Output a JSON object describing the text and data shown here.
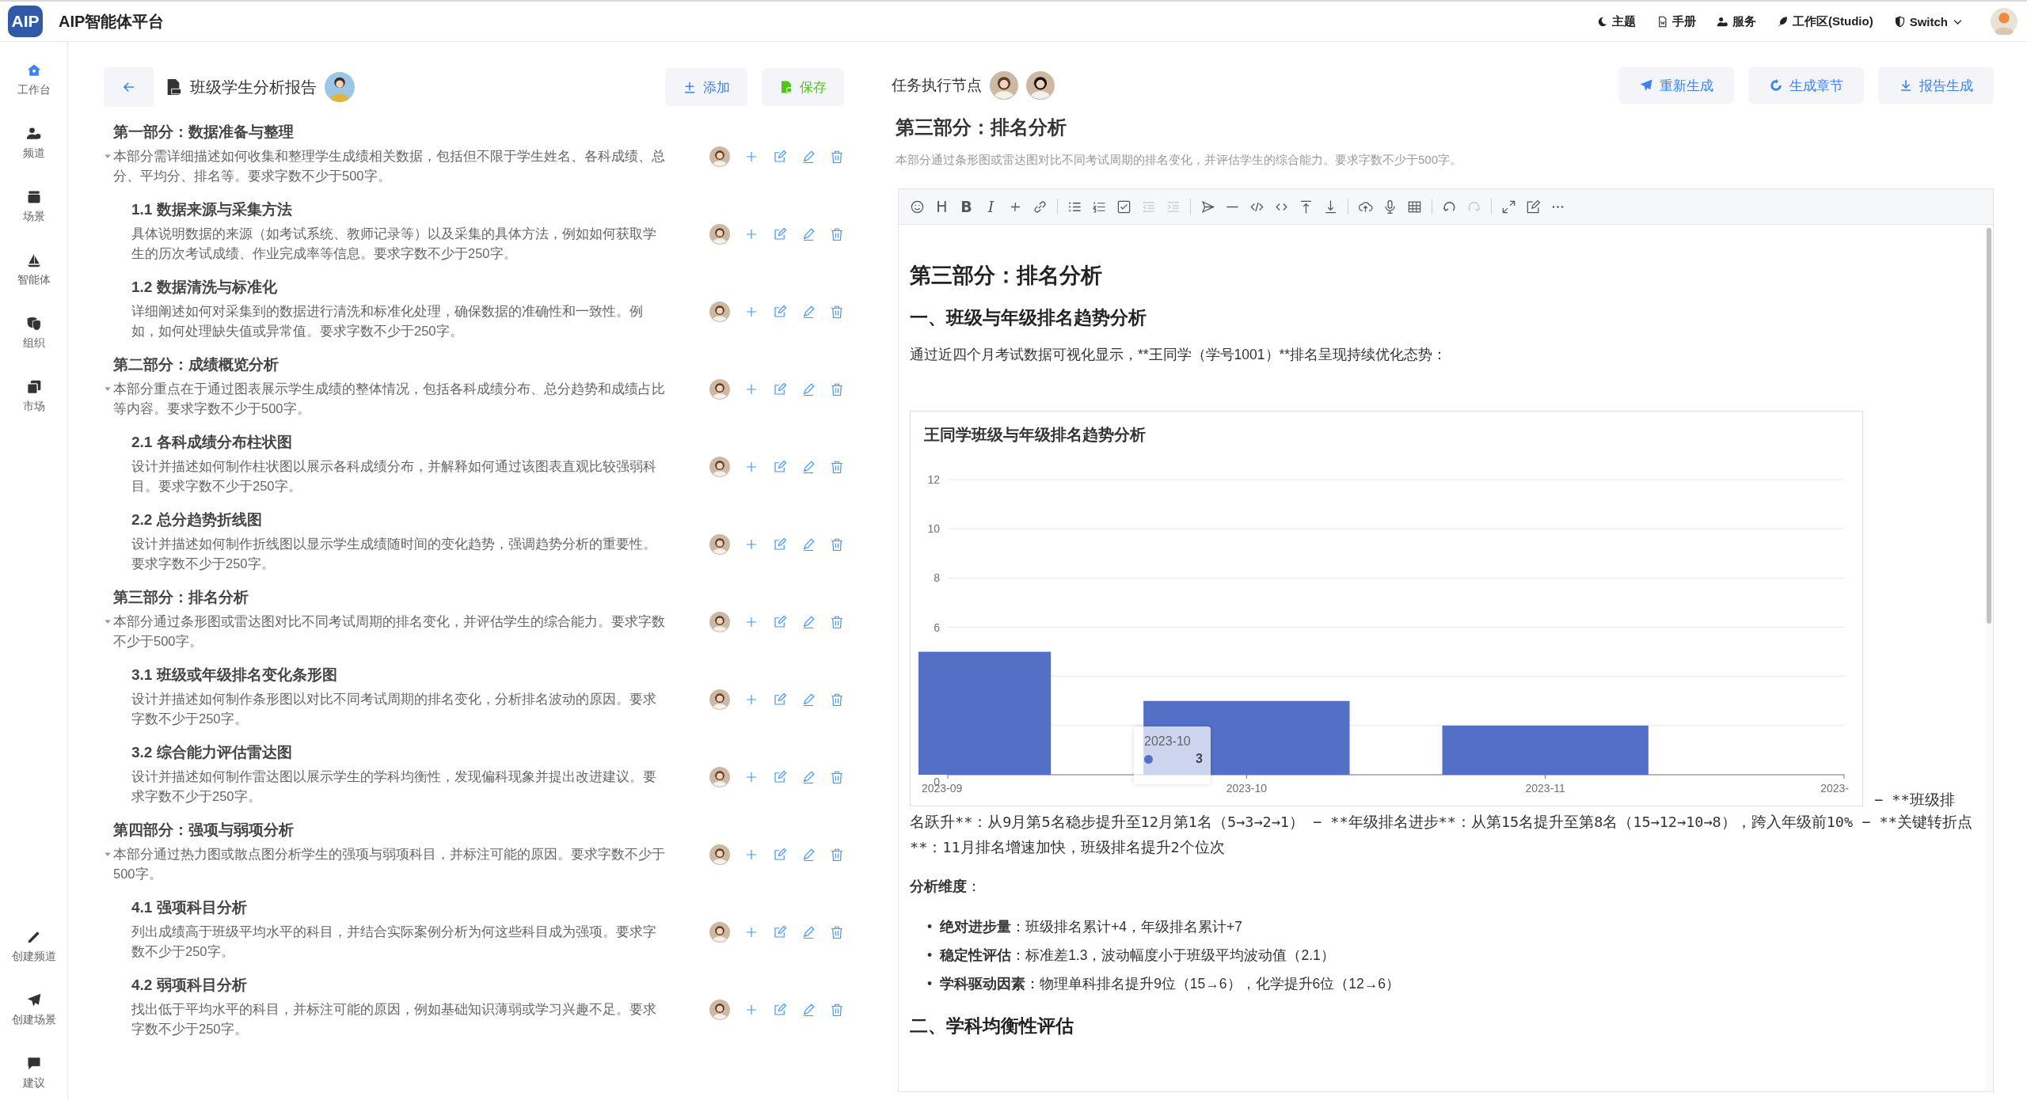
{
  "app": {
    "logo": "AIP",
    "title": "AIP智能体平台"
  },
  "top_nav": [
    {
      "label": "主题"
    },
    {
      "label": "手册"
    },
    {
      "label": "服务"
    },
    {
      "label": "工作区(Studio)"
    },
    {
      "label": "Switch"
    }
  ],
  "sidebar": {
    "items": [
      {
        "label": "工作台",
        "selected": true
      },
      {
        "label": "频道",
        "selected": false
      },
      {
        "label": "场景",
        "selected": false
      },
      {
        "label": "智能体",
        "selected": false
      },
      {
        "label": "组织",
        "selected": false
      },
      {
        "label": "市场",
        "selected": false
      }
    ],
    "bottom_items": [
      {
        "label": "创建频道"
      },
      {
        "label": "创建场景"
      },
      {
        "label": "建议"
      }
    ]
  },
  "outline": {
    "title": "班级学生分析报告",
    "buttons": [
      {
        "label": "添加",
        "kind": "add"
      },
      {
        "label": "保存",
        "kind": "save"
      }
    ],
    "sections": [
      {
        "title": "第一部分：数据准备与整理",
        "description": "本部分需详细描述如何收集和整理学生成绩相关数据，包括但不限于学生姓名、各科成绩、总分、平均分、排名等。要求字数不少于500字。",
        "expanded": true,
        "children": [
          {
            "title": "1.1 数据来源与采集方法",
            "description": "具体说明数据的来源（如考试系统、教师记录等）以及采集的具体方法，例如如何获取学生的历次考试成绩、作业完成率等信息。要求字数不少于250字。"
          },
          {
            "title": "1.2 数据清洗与标准化",
            "description": "详细阐述如何对采集到的数据进行清洗和标准化处理，确保数据的准确性和一致性。例如，如何处理缺失值或异常值。要求字数不少于250字。"
          }
        ]
      },
      {
        "title": "第二部分：成绩概览分析",
        "description": "本部分重点在于通过图表展示学生成绩的整体情况，包括各科成绩分布、总分趋势和成绩占比等内容。要求字数不少于500字。",
        "expanded": true,
        "children": [
          {
            "title": "2.1 各科成绩分布柱状图",
            "description": "设计并描述如何制作柱状图以展示各科成绩分布，并解释如何通过该图表直观比较强弱科目。要求字数不少于250字。"
          },
          {
            "title": "2.2 总分趋势折线图",
            "description": "设计并描述如何制作折线图以显示学生成绩随时间的变化趋势，强调趋势分析的重要性。要求字数不少于250字。"
          }
        ]
      },
      {
        "title": "第三部分：排名分析",
        "description": "本部分通过条形图或雷达图对比不同考试周期的排名变化，并评估学生的综合能力。要求字数不少于500字。",
        "expanded": true,
        "children": [
          {
            "title": "3.1 班级或年级排名变化条形图",
            "description": "设计并描述如何制作条形图以对比不同考试周期的排名变化，分析排名波动的原因。要求字数不少于250字。"
          },
          {
            "title": "3.2 综合能力评估雷达图",
            "description": "设计并描述如何制作雷达图以展示学生的学科均衡性，发现偏科现象并提出改进建议。要求字数不少于250字。"
          }
        ]
      },
      {
        "title": "第四部分：强项与弱项分析",
        "description": "本部分通过热力图或散点图分析学生的强项与弱项科目，并标注可能的原因。要求字数不少于500字。",
        "expanded": true,
        "children": [
          {
            "title": "4.1 强项科目分析",
            "description": "列出成绩高于班级平均水平的科目，并结合实际案例分析为何这些科目成为强项。要求字数不少于250字。"
          },
          {
            "title": "4.2 弱项科目分析",
            "description": "找出低于平均水平的科目，并标注可能的原因，例如基础知识薄弱或学习兴趣不足。要求字数不少于250字。"
          }
        ]
      }
    ]
  },
  "task": {
    "label": "任务执行节点",
    "buttons": [
      {
        "label": "重新生成"
      },
      {
        "label": "生成章节"
      },
      {
        "label": "报告生成"
      }
    ],
    "section_title": "第三部分：排名分析",
    "section_description": "本部分通过条形图或雷达图对比不同考试周期的排名变化，并评估学生的综合能力。要求字数不少于500字。",
    "toolbar": [
      {
        "kind": "icon",
        "disabled": false
      },
      {
        "kind": "glyph",
        "text": "H",
        "disabled": false
      },
      {
        "kind": "glyph",
        "text": "B",
        "disabled": false
      },
      {
        "kind": "glyph",
        "text": "I",
        "disabled": false
      },
      {
        "kind": "icon",
        "disabled": false
      },
      {
        "kind": "icon",
        "disabled": false
      },
      {
        "kind": "divider"
      },
      {
        "kind": "icon",
        "disabled": false
      },
      {
        "kind": "icon",
        "disabled": false
      },
      {
        "kind": "icon",
        "disabled": false
      },
      {
        "kind": "icon",
        "disabled": true
      },
      {
        "kind": "icon",
        "disabled": true
      },
      {
        "kind": "divider"
      },
      {
        "kind": "icon",
        "disabled": false
      },
      {
        "kind": "icon",
        "disabled": false
      },
      {
        "kind": "icon",
        "disabled": false
      },
      {
        "kind": "icon",
        "disabled": false
      },
      {
        "kind": "icon",
        "disabled": false
      },
      {
        "kind": "icon",
        "disabled": false
      },
      {
        "kind": "divider"
      },
      {
        "kind": "icon",
        "disabled": false
      },
      {
        "kind": "icon",
        "disabled": false
      },
      {
        "kind": "icon",
        "disabled": false
      },
      {
        "kind": "divider"
      },
      {
        "kind": "icon",
        "disabled": false
      },
      {
        "kind": "icon",
        "disabled": true
      },
      {
        "kind": "divider"
      },
      {
        "kind": "icon",
        "disabled": false
      },
      {
        "kind": "icon",
        "disabled": false
      },
      {
        "kind": "icon",
        "disabled": false
      }
    ],
    "editor": {
      "heading": "第三部分：排名分析",
      "subheading": "一、班级与年级排名趋势分析",
      "intro": "通过近四个月考试数据可视化显示，**王同学（学号1001）**排名呈现持续优化态势：",
      "chart_data": {
        "type": "bar",
        "title": "王同学班级与年级排名趋势分析",
        "categories": [
          "2023-09",
          "2023-10",
          "2023-11",
          "2023-"
        ],
        "series": [
          {
            "color": "#5470c6",
            "values": [
              5,
              3,
              2,
              null
            ]
          }
        ],
        "ylim": [
          0,
          12
        ],
        "yticks": [
          0,
          6,
          8,
          10,
          12
        ],
        "grid": true
      },
      "tooltip": {
        "label": "2023-10",
        "value": "3"
      },
      "after_chart": "− **班级排",
      "paragraph": "名跃升**：从9月第5名稳步提升至12月第1名（5→3→2→1） − **年级排名进步**：从第15名提升至第8名（15→12→10→8），跨入年级前10% − **关键转折点**：11月排名增速加快，班级排名提升2个位次",
      "dimensions_label": "**分析维度**：",
      "bullets": [
        {
          "marker": "•",
          "text": "**绝对进步量**：班级排名累计+4，年级排名累计+7"
        },
        {
          "marker": "•",
          "text": "**稳定性评估**：标准差1.3，波动幅度小于班级平均波动值（2.1）"
        },
        {
          "marker": "•",
          "text": "**学科驱动因素**：物理单科排名提升9位（15→6），化学提升6位（12→6）"
        }
      ],
      "subheading_2": "二、学科均衡性评估"
    }
  }
}
